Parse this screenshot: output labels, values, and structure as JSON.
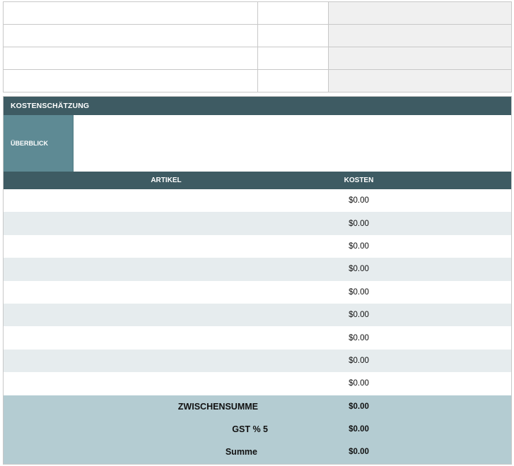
{
  "top_grid": {
    "rows": [
      [
        "",
        "",
        ""
      ],
      [
        "",
        "",
        ""
      ],
      [
        "",
        "",
        ""
      ],
      [
        "",
        "",
        ""
      ]
    ]
  },
  "estimate": {
    "section_title": "KOSTENSCHÄTZUNG",
    "overview_label": "ÜBERBLICK",
    "overview_value": "",
    "columns": {
      "item": "ARTIKEL",
      "cost": "KOSTEN"
    },
    "items": [
      {
        "name": "",
        "cost": "$0.00"
      },
      {
        "name": "",
        "cost": "$0.00"
      },
      {
        "name": "",
        "cost": "$0.00"
      },
      {
        "name": "",
        "cost": "$0.00"
      },
      {
        "name": "",
        "cost": "$0.00"
      },
      {
        "name": "",
        "cost": "$0.00"
      },
      {
        "name": "",
        "cost": "$0.00"
      },
      {
        "name": "",
        "cost": "$0.00"
      },
      {
        "name": "",
        "cost": "$0.00"
      }
    ],
    "subtotal_label": "ZWISCHENSUMME",
    "subtotal_value": "$0.00",
    "gst_label": "GST % 5",
    "gst_value": "$0.00",
    "total_label": "Summe",
    "total_value": "$0.00"
  },
  "colors": {
    "header_dark": "#3e5b63",
    "overview_label_bg": "#5e8a94",
    "alt_row": "#e6ecee",
    "summary_bg": "#b4ccd2",
    "top_grid_shaded": "#f0f0f0"
  }
}
